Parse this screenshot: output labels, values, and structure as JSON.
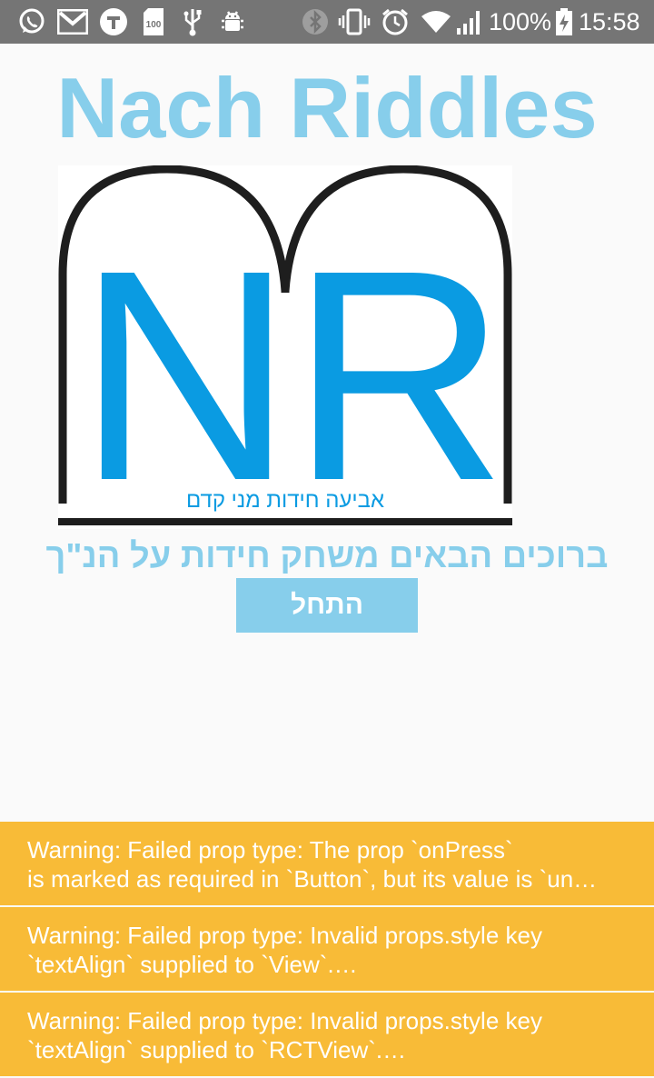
{
  "status_bar": {
    "battery_percent": "100%",
    "time": "15:58",
    "left_icons": [
      "whatsapp-icon",
      "gmail-icon",
      "t-app-icon",
      "storage-100-icon",
      "usb-icon",
      "android-debug-icon"
    ],
    "right_icons": [
      "bluetooth-icon",
      "vibrate-icon",
      "alarm-icon",
      "wifi-icon",
      "signal-icon",
      "battery-charging-icon"
    ],
    "colors": {
      "background": "#757575",
      "foreground": "#ffffff"
    }
  },
  "app": {
    "title": "Nach Riddles",
    "logo": {
      "letters": "NR",
      "tagline": "אביעה חידות מני קדם",
      "colors": {
        "letters": "#0a9be2",
        "arch": "#1e1e1e"
      }
    },
    "welcome_text": "ברוכים הבאים משחק חידות על הנ\"ך",
    "start_button_label": "התחל",
    "accent_color": "#87ceeb"
  },
  "warnings": [
    {
      "line1": "Warning: Failed prop type: The prop `onPress`",
      "line2": "is marked as required in `Button`, but its value is `un…"
    },
    {
      "line1": "Warning: Failed prop type: Invalid props.style key",
      "line2": "`textAlign` supplied to `View`.…"
    },
    {
      "line1": "Warning: Failed prop type: Invalid props.style key",
      "line2": "`textAlign` supplied to `RCTView`.…"
    }
  ],
  "warning_color": "#f8bb37"
}
